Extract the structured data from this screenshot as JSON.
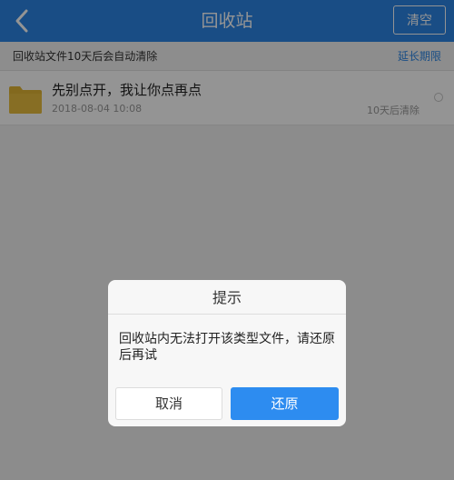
{
  "header": {
    "title": "回收站",
    "clear_label": "清空"
  },
  "notice": {
    "text": "回收站文件10天后会自动清除",
    "extend_label": "延长期限"
  },
  "files": [
    {
      "name": "先别点开，我让你点再点",
      "date": "2018-08-04  10:08",
      "expire": "10天后清除"
    }
  ],
  "dialog": {
    "title": "提示",
    "message": "回收站内无法打开该类型文件，请还原后再试",
    "cancel_label": "取消",
    "restore_label": "还原"
  },
  "colors": {
    "accent": "#2b86e6",
    "folder": "#e2b534",
    "button_primary": "#2d8cf0"
  }
}
